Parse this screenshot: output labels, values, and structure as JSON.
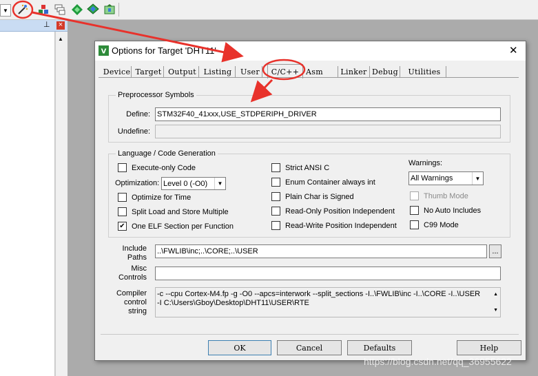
{
  "dialog": {
    "title": "Options for Target 'DHT11'",
    "close_glyph": "✕",
    "tabs": [
      "Device",
      "Target",
      "Output",
      "Listing",
      "User",
      "C/C++",
      "Asm",
      "Linker",
      "Debug",
      "Utilities"
    ],
    "active_tab": "C/C++"
  },
  "preprocessor": {
    "group_label": "Preprocessor Symbols",
    "define_label": "Define:",
    "define_value": "STM32F40_41xxx,USE_STDPERIPH_DRIVER",
    "undefine_label": "Undefine:",
    "undefine_value": ""
  },
  "language": {
    "group_label": "Language / Code Generation",
    "execute_only": {
      "label": "Execute-only Code",
      "checked": false
    },
    "optimization_label": "Optimization:",
    "optimization_value": "Level 0 (-O0)",
    "optimize_time": {
      "label": "Optimize for Time",
      "checked": false
    },
    "split_load": {
      "label": "Split Load and Store Multiple",
      "checked": false
    },
    "one_elf": {
      "label": "One ELF Section per Function",
      "checked": true,
      "mark": "✔"
    },
    "strict_ansi": {
      "label": "Strict ANSI C",
      "checked": false
    },
    "enum_container": {
      "label": "Enum Container always int",
      "checked": false
    },
    "plain_char": {
      "label": "Plain Char is Signed",
      "checked": false
    },
    "ro_pos": {
      "label": "Read-Only Position Independent",
      "checked": false
    },
    "rw_pos": {
      "label": "Read-Write Position Independent",
      "checked": false
    },
    "warnings_label": "Warnings:",
    "warnings_value": "All Warnings",
    "thumb_mode": {
      "label": "Thumb Mode",
      "checked": false,
      "disabled": true
    },
    "no_auto_includes": {
      "label": "No Auto Includes",
      "checked": false
    },
    "c99_mode": {
      "label": "C99 Mode",
      "checked": false
    }
  },
  "include": {
    "label_line1": "Include",
    "label_line2": "Paths",
    "value": "..\\FWLIB\\inc;..\\CORE;..\\USER",
    "browse_label": "..."
  },
  "misc": {
    "label_line1": "Misc",
    "label_line2": "Controls",
    "value": ""
  },
  "compiler": {
    "label_line1": "Compiler",
    "label_line2": "control",
    "label_line3": "string",
    "line1": "-c --cpu Cortex-M4.fp -g -O0 --apcs=interwork --split_sections -I..\\FWLIB\\inc -I..\\CORE -I..\\USER",
    "line2": "-I C:\\Users\\Gboy\\Desktop\\DHT11\\USER\\RTE"
  },
  "buttons": {
    "ok": "OK",
    "cancel": "Cancel",
    "defaults": "Defaults",
    "help": "Help"
  },
  "watermark": "https://blog.csdn.net/qq_36955622",
  "colors": {
    "annotation_red": "#e8322b",
    "dialog_bg": "#f0f0f0",
    "panel_header": "#c9dcf3"
  },
  "icons": {
    "dropdown": "▼",
    "pin": "⊥",
    "panel_close": "×",
    "scroll_up": "▲",
    "scroll_down": "▼"
  }
}
